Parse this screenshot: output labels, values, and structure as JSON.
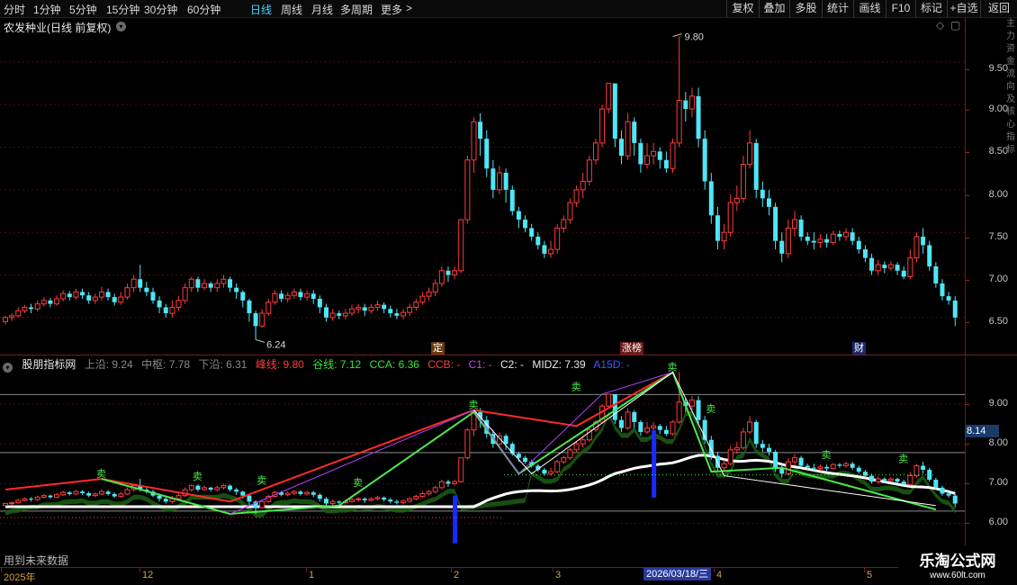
{
  "toolbar": {
    "periods": [
      "分时",
      "1分钟",
      "5分钟",
      "15分钟",
      "30分钟",
      "60分钟",
      "日线",
      "周线",
      "月线",
      "多周期",
      "更多"
    ],
    "active_period": "日线",
    "more_chevron": ">",
    "buttons": [
      "复权",
      "叠加",
      "多股",
      "统计",
      "画线",
      "F10",
      "标记",
      "+自选",
      "返回"
    ]
  },
  "main_pane": {
    "title": "农发种业(日线 前复权)",
    "high_label": "9.80",
    "low_label": "6.24",
    "events": [
      "定",
      "涨榜",
      "财"
    ]
  },
  "indicator": {
    "name": "股朋指标网",
    "upper": "上沿: 9.24",
    "middle": "中枢: 7.78",
    "lower": "下沿: 6.31",
    "peak": "峰线: 9.80",
    "valley": "谷线: 7.12",
    "cca": "CCA: 6.36",
    "ccb": "CCB: -",
    "c1": "C1: -",
    "c2": "C2: -",
    "midz": "MIDZ: 7.39",
    "a15d": "A15D: -",
    "current_value": "8.14",
    "sell_marks": [
      "卖",
      "卖",
      "卖",
      "卖",
      "卖",
      "卖",
      "卖",
      "卖",
      "卖",
      "卖"
    ]
  },
  "price_axis": {
    "labels": [
      "9.50",
      "9.00",
      "8.50",
      "8.00",
      "7.50",
      "7.00",
      "6.50"
    ]
  },
  "indicator_axis": {
    "labels": [
      "9.00",
      "8.00",
      "7.00",
      "6.00"
    ]
  },
  "date_axis": {
    "labels": [
      "2025年",
      "12",
      "1",
      "2",
      "3",
      "4",
      "5"
    ],
    "cursor_date": "2026/03/18/三"
  },
  "footer": {
    "note": "用到未来数据"
  },
  "watermark": {
    "title": "乐淘公式网",
    "url": "www.60lt.com"
  },
  "right_strip": {
    "text": "主力资金流向及核心指标"
  },
  "colors": {
    "up": "#ff3c3c",
    "down": "#4fe6f5",
    "accent": "#4fd2ff",
    "bg": "#000000"
  },
  "chart_data": {
    "type": "candlestick",
    "y_range": [
      6.2,
      9.9
    ],
    "candles": [
      [
        6.45,
        6.5,
        6.42,
        6.52
      ],
      [
        6.5,
        6.52,
        6.46,
        6.55
      ],
      [
        6.52,
        6.58,
        6.5,
        6.62
      ],
      [
        6.58,
        6.62,
        6.55,
        6.65
      ],
      [
        6.62,
        6.6,
        6.55,
        6.66
      ],
      [
        6.6,
        6.66,
        6.57,
        6.7
      ],
      [
        6.66,
        6.7,
        6.63,
        6.74
      ],
      [
        6.7,
        6.66,
        6.62,
        6.73
      ],
      [
        6.66,
        6.72,
        6.64,
        6.76
      ],
      [
        6.72,
        6.78,
        6.69,
        6.82
      ],
      [
        6.78,
        6.74,
        6.7,
        6.81
      ],
      [
        6.74,
        6.8,
        6.71,
        6.84
      ],
      [
        6.8,
        6.76,
        6.72,
        6.84
      ],
      [
        6.76,
        6.7,
        6.66,
        6.8
      ],
      [
        6.7,
        6.74,
        6.66,
        6.78
      ],
      [
        6.74,
        6.8,
        6.7,
        6.86
      ],
      [
        6.8,
        6.74,
        6.7,
        6.84
      ],
      [
        6.74,
        6.68,
        6.64,
        6.78
      ],
      [
        6.68,
        6.74,
        6.65,
        6.8
      ],
      [
        6.74,
        6.85,
        6.71,
        6.9
      ],
      [
        6.85,
        6.95,
        6.8,
        7.0
      ],
      [
        6.95,
        6.85,
        6.8,
        7.12
      ],
      [
        6.85,
        6.8,
        6.75,
        6.92
      ],
      [
        6.8,
        6.7,
        6.66,
        6.85
      ],
      [
        6.7,
        6.62,
        6.55,
        6.75
      ],
      [
        6.62,
        6.55,
        6.5,
        6.66
      ],
      [
        6.55,
        6.62,
        6.5,
        6.7
      ],
      [
        6.62,
        6.7,
        6.58,
        6.75
      ],
      [
        6.7,
        6.85,
        6.66,
        6.9
      ],
      [
        6.85,
        6.95,
        6.8,
        6.98
      ],
      [
        6.95,
        6.85,
        6.8,
        6.98
      ],
      [
        6.85,
        6.9,
        6.82,
        6.95
      ],
      [
        6.9,
        6.85,
        6.8,
        6.92
      ],
      [
        6.85,
        6.9,
        6.8,
        6.95
      ],
      [
        6.9,
        6.95,
        6.85,
        7.0
      ],
      [
        6.95,
        6.85,
        6.8,
        6.98
      ],
      [
        6.85,
        6.8,
        6.72,
        6.9
      ],
      [
        6.8,
        6.7,
        6.62,
        6.82
      ],
      [
        6.7,
        6.55,
        6.45,
        6.72
      ],
      [
        6.55,
        6.4,
        6.24,
        6.58
      ],
      [
        6.4,
        6.55,
        6.38,
        6.6
      ],
      [
        6.55,
        6.68,
        6.52,
        6.72
      ],
      [
        6.68,
        6.78,
        6.65,
        6.82
      ],
      [
        6.78,
        6.72,
        6.68,
        6.82
      ],
      [
        6.72,
        6.76,
        6.68,
        6.8
      ],
      [
        6.76,
        6.8,
        6.72,
        6.84
      ],
      [
        6.8,
        6.74,
        6.7,
        6.84
      ],
      [
        6.74,
        6.78,
        6.7,
        6.82
      ],
      [
        6.78,
        6.72,
        6.66,
        6.82
      ],
      [
        6.72,
        6.62,
        6.55,
        6.76
      ],
      [
        6.62,
        6.5,
        6.45,
        6.66
      ],
      [
        6.5,
        6.55,
        6.46,
        6.6
      ],
      [
        6.55,
        6.52,
        6.48,
        6.58
      ],
      [
        6.52,
        6.55,
        6.48,
        6.6
      ],
      [
        6.55,
        6.6,
        6.52,
        6.65
      ],
      [
        6.6,
        6.62,
        6.55,
        6.66
      ],
      [
        6.62,
        6.58,
        6.52,
        6.66
      ],
      [
        6.58,
        6.62,
        6.55,
        6.66
      ],
      [
        6.62,
        6.65,
        6.58,
        6.7
      ],
      [
        6.65,
        6.6,
        6.55,
        6.68
      ],
      [
        6.6,
        6.55,
        6.5,
        6.64
      ],
      [
        6.55,
        6.52,
        6.48,
        6.6
      ],
      [
        6.52,
        6.56,
        6.48,
        6.6
      ],
      [
        6.56,
        6.62,
        6.52,
        6.66
      ],
      [
        6.62,
        6.68,
        6.58,
        6.72
      ],
      [
        6.68,
        6.75,
        6.65,
        6.8
      ],
      [
        6.75,
        6.8,
        6.7,
        6.85
      ],
      [
        6.8,
        6.9,
        6.75,
        6.95
      ],
      [
        6.9,
        7.05,
        6.86,
        7.1
      ],
      [
        7.05,
        7.0,
        6.92,
        7.1
      ],
      [
        7.0,
        7.05,
        6.95,
        7.1
      ],
      [
        7.05,
        7.65,
        7.02,
        7.65
      ],
      [
        7.65,
        8.35,
        7.6,
        8.4
      ],
      [
        8.35,
        8.8,
        8.2,
        8.85
      ],
      [
        8.8,
        8.6,
        8.4,
        8.9
      ],
      [
        8.6,
        8.25,
        8.15,
        8.7
      ],
      [
        8.25,
        8.0,
        7.9,
        8.35
      ],
      [
        8.0,
        8.2,
        7.95,
        8.28
      ],
      [
        8.2,
        8.0,
        7.85,
        8.25
      ],
      [
        8.0,
        7.75,
        7.7,
        8.05
      ],
      [
        7.75,
        7.65,
        7.55,
        7.8
      ],
      [
        7.65,
        7.55,
        7.5,
        7.7
      ],
      [
        7.55,
        7.45,
        7.4,
        7.6
      ],
      [
        7.45,
        7.35,
        7.3,
        7.5
      ],
      [
        7.35,
        7.25,
        7.2,
        7.4
      ],
      [
        7.25,
        7.3,
        7.2,
        7.4
      ],
      [
        7.3,
        7.55,
        7.25,
        7.6
      ],
      [
        7.55,
        7.65,
        7.5,
        7.7
      ],
      [
        7.65,
        7.85,
        7.6,
        7.9
      ],
      [
        7.85,
        8.0,
        7.8,
        8.05
      ],
      [
        8.0,
        8.1,
        7.9,
        8.2
      ],
      [
        8.1,
        8.35,
        8.05,
        8.4
      ],
      [
        8.35,
        8.55,
        8.3,
        8.6
      ],
      [
        8.55,
        8.95,
        8.5,
        9.0
      ],
      [
        8.95,
        9.25,
        8.9,
        9.25
      ],
      [
        9.25,
        8.6,
        8.5,
        9.25
      ],
      [
        8.6,
        8.4,
        8.3,
        8.7
      ],
      [
        8.4,
        8.8,
        8.35,
        8.9
      ],
      [
        8.8,
        8.55,
        8.4,
        8.85
      ],
      [
        8.55,
        8.3,
        8.2,
        8.6
      ],
      [
        8.3,
        8.4,
        8.25,
        8.55
      ],
      [
        8.4,
        8.45,
        8.3,
        8.55
      ],
      [
        8.45,
        8.35,
        8.25,
        8.5
      ],
      [
        8.35,
        8.25,
        8.2,
        8.45
      ],
      [
        8.25,
        8.55,
        8.2,
        8.6
      ],
      [
        8.55,
        9.05,
        8.5,
        9.8
      ],
      [
        9.05,
        8.95,
        8.8,
        9.15
      ],
      [
        8.95,
        9.1,
        8.85,
        9.2
      ],
      [
        9.1,
        8.6,
        8.5,
        9.2
      ],
      [
        8.6,
        8.1,
        8.0,
        8.7
      ],
      [
        8.1,
        7.7,
        7.6,
        8.2
      ],
      [
        7.7,
        7.4,
        7.3,
        7.8
      ],
      [
        7.4,
        7.5,
        7.3,
        7.6
      ],
      [
        7.5,
        7.85,
        7.45,
        7.95
      ],
      [
        7.85,
        7.9,
        7.75,
        8.05
      ],
      [
        7.9,
        8.3,
        7.85,
        8.4
      ],
      [
        8.3,
        8.55,
        8.25,
        8.7
      ],
      [
        8.55,
        8.0,
        7.9,
        8.6
      ],
      [
        8.0,
        7.9,
        7.8,
        8.1
      ],
      [
        7.9,
        7.8,
        7.7,
        8.0
      ],
      [
        7.8,
        7.4,
        7.3,
        7.85
      ],
      [
        7.4,
        7.25,
        7.15,
        7.5
      ],
      [
        7.25,
        7.55,
        7.2,
        7.65
      ],
      [
        7.55,
        7.65,
        7.45,
        7.75
      ],
      [
        7.65,
        7.45,
        7.4,
        7.7
      ],
      [
        7.45,
        7.4,
        7.35,
        7.5
      ],
      [
        7.4,
        7.38,
        7.3,
        7.5
      ],
      [
        7.38,
        7.42,
        7.32,
        7.48
      ],
      [
        7.42,
        7.38,
        7.32,
        7.48
      ],
      [
        7.38,
        7.48,
        7.35,
        7.52
      ],
      [
        7.48,
        7.45,
        7.4,
        7.52
      ],
      [
        7.45,
        7.5,
        7.4,
        7.55
      ],
      [
        7.5,
        7.4,
        7.35,
        7.55
      ],
      [
        7.4,
        7.3,
        7.25,
        7.45
      ],
      [
        7.3,
        7.2,
        7.15,
        7.35
      ],
      [
        7.2,
        7.05,
        7.0,
        7.25
      ],
      [
        7.05,
        7.12,
        7.0,
        7.18
      ],
      [
        7.12,
        7.08,
        7.02,
        7.16
      ],
      [
        7.08,
        7.12,
        7.05,
        7.16
      ],
      [
        7.12,
        7.05,
        7.0,
        7.15
      ],
      [
        7.05,
        6.98,
        6.95,
        7.1
      ],
      [
        6.98,
        7.2,
        6.95,
        7.3
      ],
      [
        7.2,
        7.45,
        7.15,
        7.5
      ],
      [
        7.45,
        7.35,
        7.25,
        7.55
      ],
      [
        7.35,
        7.1,
        7.05,
        7.4
      ],
      [
        7.1,
        6.9,
        6.85,
        7.15
      ],
      [
        6.9,
        6.75,
        6.7,
        6.95
      ],
      [
        6.75,
        6.7,
        6.65,
        6.8
      ],
      [
        6.7,
        6.5,
        6.4,
        6.75
      ]
    ]
  }
}
